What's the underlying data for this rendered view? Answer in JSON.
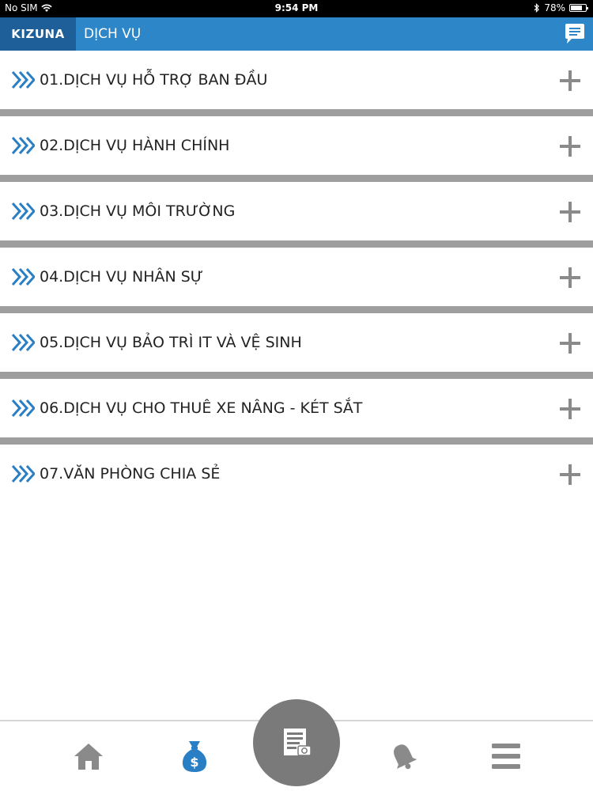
{
  "status_bar": {
    "carrier": "No SIM",
    "time": "9:54 PM",
    "battery_percent": "78%",
    "battery_level": 0.78,
    "icons": [
      "wifi-icon",
      "bluetooth-icon",
      "battery-icon"
    ]
  },
  "header": {
    "logo": "KIZUNA",
    "title": "DỊCH VỤ",
    "background": "#2d86c7",
    "logo_background": "#1f5f99",
    "chat_icon": "chat-icon"
  },
  "services": [
    {
      "label": "01.DỊCH VỤ HỖ TRỢ BAN ĐẦU"
    },
    {
      "label": "02.DỊCH VỤ HÀNH CHÍNH"
    },
    {
      "label": "03.DỊCH VỤ MÔI TRƯỜNG"
    },
    {
      "label": "04.DỊCH VỤ NHÂN SỰ"
    },
    {
      "label": "05.DỊCH VỤ BẢO TRÌ IT VÀ VỆ SINH"
    },
    {
      "label": "06.DỊCH VỤ CHO THUÊ XE NÂNG - KÉT SẮT"
    },
    {
      "label": "07.VĂN PHÒNG CHIA SẺ"
    }
  ],
  "colors": {
    "accent": "#2d86c7",
    "chevron": "#2a7fc4",
    "plus": "#8a8a8a",
    "divider": "#9e9e9e",
    "tab_inactive": "#8a8a8a",
    "tab_active": "#2a7fc4"
  },
  "bottom_tabs": [
    {
      "icon": "home-icon",
      "active": false
    },
    {
      "icon": "money-bag-icon",
      "active": true
    },
    {
      "icon": "document-camera-icon",
      "active": false,
      "center": true
    },
    {
      "icon": "bell-icon",
      "active": false
    },
    {
      "icon": "menu-icon",
      "active": false
    }
  ]
}
